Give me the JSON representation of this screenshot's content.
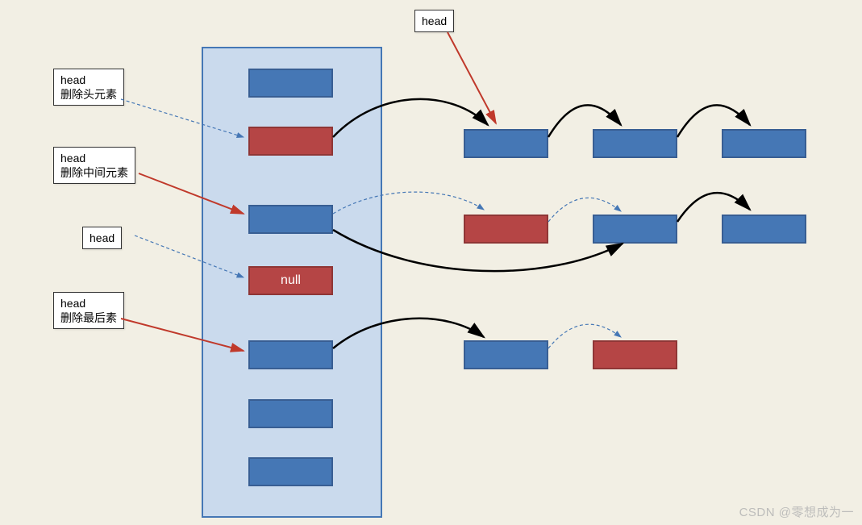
{
  "labels": {
    "head_top": "head",
    "remove_head": "head\n删除头元素",
    "remove_middle": "head\n删除中间元素",
    "head_mid": "head",
    "remove_last": "head\n删除最后素"
  },
  "null_text": "null",
  "watermark": "CSDN @零想成为一"
}
